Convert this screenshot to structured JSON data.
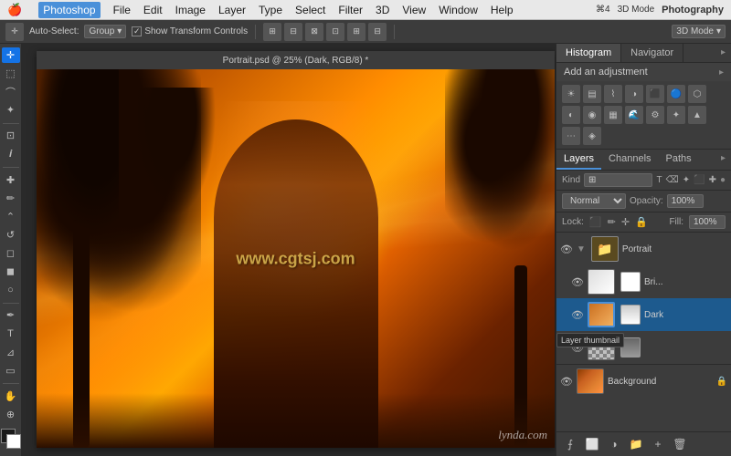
{
  "app": {
    "title": "Photoshop",
    "workspace": "Photography"
  },
  "menubar": {
    "apple": "⌘",
    "items": [
      "Photoshop",
      "File",
      "Edit",
      "Image",
      "Layer",
      "Type",
      "Select",
      "Filter",
      "3D",
      "View",
      "Window",
      "Help"
    ],
    "right": [
      "⌘4",
      "3D Mode",
      "Photography"
    ]
  },
  "optionsbar": {
    "auto_select_label": "Auto-Select:",
    "group_value": "Group",
    "show_transform": "Show Transform Controls",
    "three_d_mode": "3D Mode"
  },
  "panels": {
    "histogram_tab": "Histogram",
    "navigator_tab": "Navigator",
    "adjustments_title": "Add an adjustment",
    "adjustments_icons": [
      "☀",
      "◑",
      "◐",
      "⬛",
      "🔵",
      "◯",
      "◉",
      "▦",
      "🌊",
      "⚙",
      "✦",
      "▲"
    ]
  },
  "layers": {
    "tabs": [
      "Layers",
      "Channels",
      "Paths"
    ],
    "filter_label": "Kind",
    "blend_mode": "Normal",
    "opacity_label": "Opacity:",
    "opacity_value": "100%",
    "fill_label": "Fill:",
    "fill_value": "100%",
    "lock_label": "Lock:",
    "items": [
      {
        "visible": true,
        "type": "group",
        "name": "Portrait",
        "expanded": true,
        "children": [
          {
            "visible": true,
            "type": "layer",
            "name": "Bri...",
            "has_mask": true,
            "selected": false
          },
          {
            "visible": true,
            "type": "layer",
            "name": "Dark",
            "has_mask": true,
            "selected": true,
            "tooltip": "Layer thumbnail"
          },
          {
            "visible": true,
            "type": "layer",
            "name": "",
            "has_mask": true,
            "selected": false
          }
        ]
      },
      {
        "visible": true,
        "type": "layer",
        "name": "Background",
        "has_mask": false,
        "selected": false,
        "locked": true
      }
    ]
  },
  "canvas": {
    "title": "Portrait.psd @ 25% (Dark, RGB/8) *",
    "watermark": "www.cgtsj.com"
  },
  "lynda": {
    "text": "lynda.com"
  }
}
